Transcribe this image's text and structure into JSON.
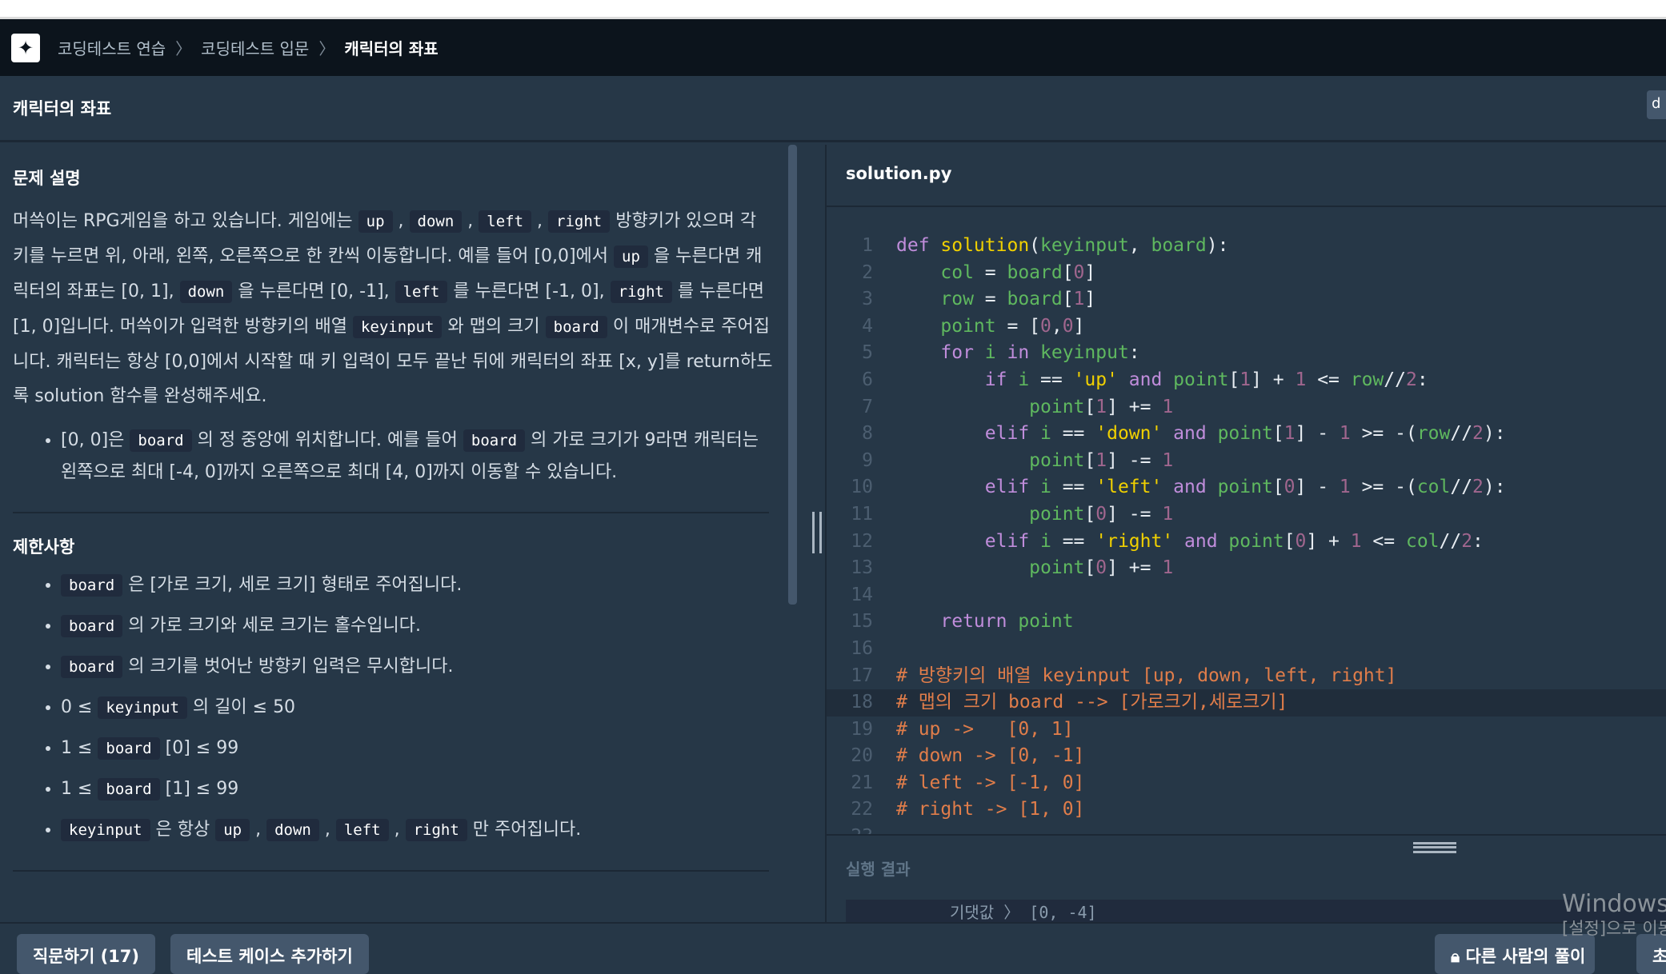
{
  "nav": {
    "breadcrumbs": [
      "코딩테스트 연습",
      "코딩테스트 입문",
      "캐릭터의 좌표"
    ]
  },
  "header": {
    "title": "캐릭터의 좌표",
    "right_button": "d"
  },
  "problem": {
    "section_title": "문제 설명",
    "paragraph": [
      {
        "t": "머쓱이는 RPG게임을 하고 있습니다. 게임에는 "
      },
      {
        "c": "up"
      },
      {
        "t": " , "
      },
      {
        "c": "down"
      },
      {
        "t": " , "
      },
      {
        "c": "left"
      },
      {
        "t": " , "
      },
      {
        "c": "right"
      },
      {
        "t": " 방향키가 있으며 각 키를 누르면 위, 아래, 왼쪽, 오른쪽으로 한 칸씩 이동합니다. 예를 들어 [0,0]에서 "
      },
      {
        "c": "up"
      },
      {
        "t": " 을 누른다면 캐릭터의 좌표는 [0, 1], "
      },
      {
        "c": "down"
      },
      {
        "t": " 을 누른다면 [0, -1], "
      },
      {
        "c": "left"
      },
      {
        "t": " 를 누른다면 [-1, 0], "
      },
      {
        "c": "right"
      },
      {
        "t": " 를 누른다면 [1, 0]입니다. 머쓱이가 입력한 방향키의 배열 "
      },
      {
        "c": "keyinput"
      },
      {
        "t": " 와 맵의 크기 "
      },
      {
        "c": "board"
      },
      {
        "t": " 이 매개변수로 주어집니다. 캐릭터는 항상 [0,0]에서 시작할 때 키 입력이 모두 끝난 뒤에 캐릭터의 좌표 [x, y]를 return하도록 solution 함수를 완성해주세요."
      }
    ],
    "bullets": [
      [
        {
          "t": "[0, 0]은 "
        },
        {
          "c": "board"
        },
        {
          "t": " 의 정 중앙에 위치합니다. 예를 들어 "
        },
        {
          "c": "board"
        },
        {
          "t": " 의 가로 크기가 9라면 캐릭터는 왼쪽으로 최대 [-4, 0]까지 오른쪽으로 최대 [4, 0]까지 이동할 수 있습니다."
        }
      ]
    ]
  },
  "constraints": {
    "section_title": "제한사항",
    "bullets": [
      [
        {
          "c": "board"
        },
        {
          "t": " 은 [가로 크기, 세로 크기] 형태로 주어집니다."
        }
      ],
      [
        {
          "c": "board"
        },
        {
          "t": " 의 가로 크기와 세로 크기는 홀수입니다."
        }
      ],
      [
        {
          "c": "board"
        },
        {
          "t": " 의 크기를 벗어난 방향키 입력은 무시합니다."
        }
      ],
      [
        {
          "t": "0 ≤ "
        },
        {
          "c": "keyinput"
        },
        {
          "t": " 의 길이 ≤ 50"
        }
      ],
      [
        {
          "t": "1 ≤ "
        },
        {
          "c": "board"
        },
        {
          "t": " [0] ≤ 99"
        }
      ],
      [
        {
          "t": "1 ≤ "
        },
        {
          "c": "board"
        },
        {
          "t": " [1] ≤ 99"
        }
      ],
      [
        {
          "c": "keyinput"
        },
        {
          "t": " 은 항상 "
        },
        {
          "c": "up"
        },
        {
          "t": " , "
        },
        {
          "c": "down"
        },
        {
          "t": " , "
        },
        {
          "c": "left"
        },
        {
          "t": " , "
        },
        {
          "c": "right"
        },
        {
          "t": " 만 주어집니다."
        }
      ]
    ]
  },
  "editor": {
    "filename": "solution.py",
    "active_line": 18,
    "lines": [
      "def solution(keyinput, board):",
      "    col = board[0]",
      "    row = board[1]",
      "    point = [0,0]",
      "    for i in keyinput:",
      "        if i == 'up' and point[1] + 1 <= row//2:",
      "            point[1] += 1",
      "        elif i == 'down' and point[1] - 1 >= -(row//2):",
      "            point[1] -= 1",
      "        elif i == 'left' and point[0] - 1 >= -(col//2):",
      "            point[0] -= 1",
      "        elif i == 'right' and point[0] + 1 <= col//2:",
      "            point[0] += 1",
      "",
      "    return point",
      "",
      "# 방향키의 배열 keyinput [up, down, left, right]",
      "# 맵의 크기 board --> [가로크기,세로크기]",
      "# up ->   [0, 1]",
      "# down -> [0, -1]",
      "# left -> [-1, 0]",
      "# right -> [1, 0]",
      ""
    ]
  },
  "result": {
    "label": "실행 결과",
    "output": "기댓값 〉 [0, -4]"
  },
  "buttons": {
    "ask": "직문하기 (17)",
    "add_test": "테스트 케이스 추가하기",
    "others": "다른 사람의 풀이",
    "next": "초"
  },
  "watermark": {
    "line1": "Windows 정품 인증",
    "line2": "[설정]으로 이동하여 Windows를 정품 인증합니다."
  },
  "colors": {
    "nav_bg": "#0c141c",
    "panel_bg": "#263747",
    "keyword": "#c08ddb",
    "function": "#f0d000",
    "variable": "#5fb85f",
    "number": "#a0668e",
    "comment": "#e07d4a"
  }
}
